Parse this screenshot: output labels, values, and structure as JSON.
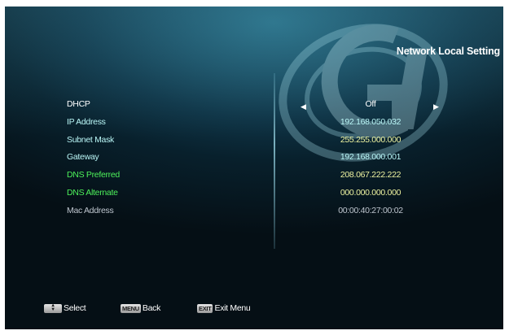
{
  "header": {
    "title": "Network Local Setting",
    "logo_text": "Gi"
  },
  "settings": [
    {
      "label": "DHCP",
      "value": "Off"
    },
    {
      "label": "IP Address",
      "value": "192.168.050.032"
    },
    {
      "label": "Subnet Mask",
      "value": "255.255.000.000"
    },
    {
      "label": "Gateway",
      "value": "192.168.000.001"
    },
    {
      "label": "DNS Preferred",
      "value": "208.067.222.222"
    },
    {
      "label": "DNS Alternate",
      "value": "000.000.000.000"
    },
    {
      "label": "Mac Address",
      "value": "00:00:40:27:00:02"
    }
  ],
  "footer": {
    "select_key_icon": "up-down-arrows-icon",
    "select_label": "Select",
    "menu_key": "MENU",
    "back_label": "Back",
    "exit_key": "EXIT",
    "exit_label": "Exit Menu"
  },
  "colors": {
    "background_top": "#2a6f86",
    "background_bottom": "#050f15",
    "label_white": "#ffffff",
    "label_cyan": "#b9f6f6",
    "label_yellow": "#eef3a0",
    "label_green": "#4df05a",
    "label_gray": "#bfc6cf"
  }
}
